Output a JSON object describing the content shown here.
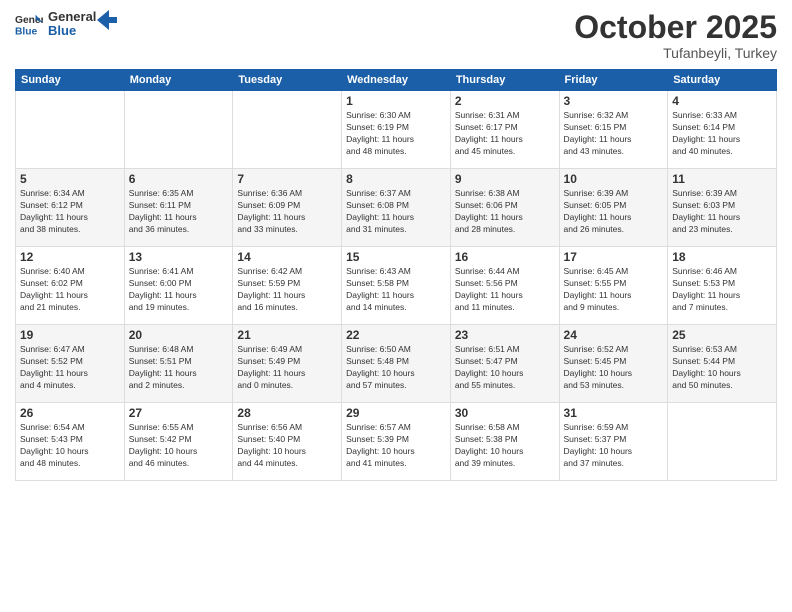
{
  "header": {
    "logo_general": "General",
    "logo_blue": "Blue",
    "month_title": "October 2025",
    "subtitle": "Tufanbeyli, Turkey"
  },
  "days_of_week": [
    "Sunday",
    "Monday",
    "Tuesday",
    "Wednesday",
    "Thursday",
    "Friday",
    "Saturday"
  ],
  "weeks": [
    [
      {
        "day": "",
        "info": ""
      },
      {
        "day": "",
        "info": ""
      },
      {
        "day": "",
        "info": ""
      },
      {
        "day": "1",
        "info": "Sunrise: 6:30 AM\nSunset: 6:19 PM\nDaylight: 11 hours\nand 48 minutes."
      },
      {
        "day": "2",
        "info": "Sunrise: 6:31 AM\nSunset: 6:17 PM\nDaylight: 11 hours\nand 45 minutes."
      },
      {
        "day": "3",
        "info": "Sunrise: 6:32 AM\nSunset: 6:15 PM\nDaylight: 11 hours\nand 43 minutes."
      },
      {
        "day": "4",
        "info": "Sunrise: 6:33 AM\nSunset: 6:14 PM\nDaylight: 11 hours\nand 40 minutes."
      }
    ],
    [
      {
        "day": "5",
        "info": "Sunrise: 6:34 AM\nSunset: 6:12 PM\nDaylight: 11 hours\nand 38 minutes."
      },
      {
        "day": "6",
        "info": "Sunrise: 6:35 AM\nSunset: 6:11 PM\nDaylight: 11 hours\nand 36 minutes."
      },
      {
        "day": "7",
        "info": "Sunrise: 6:36 AM\nSunset: 6:09 PM\nDaylight: 11 hours\nand 33 minutes."
      },
      {
        "day": "8",
        "info": "Sunrise: 6:37 AM\nSunset: 6:08 PM\nDaylight: 11 hours\nand 31 minutes."
      },
      {
        "day": "9",
        "info": "Sunrise: 6:38 AM\nSunset: 6:06 PM\nDaylight: 11 hours\nand 28 minutes."
      },
      {
        "day": "10",
        "info": "Sunrise: 6:39 AM\nSunset: 6:05 PM\nDaylight: 11 hours\nand 26 minutes."
      },
      {
        "day": "11",
        "info": "Sunrise: 6:39 AM\nSunset: 6:03 PM\nDaylight: 11 hours\nand 23 minutes."
      }
    ],
    [
      {
        "day": "12",
        "info": "Sunrise: 6:40 AM\nSunset: 6:02 PM\nDaylight: 11 hours\nand 21 minutes."
      },
      {
        "day": "13",
        "info": "Sunrise: 6:41 AM\nSunset: 6:00 PM\nDaylight: 11 hours\nand 19 minutes."
      },
      {
        "day": "14",
        "info": "Sunrise: 6:42 AM\nSunset: 5:59 PM\nDaylight: 11 hours\nand 16 minutes."
      },
      {
        "day": "15",
        "info": "Sunrise: 6:43 AM\nSunset: 5:58 PM\nDaylight: 11 hours\nand 14 minutes."
      },
      {
        "day": "16",
        "info": "Sunrise: 6:44 AM\nSunset: 5:56 PM\nDaylight: 11 hours\nand 11 minutes."
      },
      {
        "day": "17",
        "info": "Sunrise: 6:45 AM\nSunset: 5:55 PM\nDaylight: 11 hours\nand 9 minutes."
      },
      {
        "day": "18",
        "info": "Sunrise: 6:46 AM\nSunset: 5:53 PM\nDaylight: 11 hours\nand 7 minutes."
      }
    ],
    [
      {
        "day": "19",
        "info": "Sunrise: 6:47 AM\nSunset: 5:52 PM\nDaylight: 11 hours\nand 4 minutes."
      },
      {
        "day": "20",
        "info": "Sunrise: 6:48 AM\nSunset: 5:51 PM\nDaylight: 11 hours\nand 2 minutes."
      },
      {
        "day": "21",
        "info": "Sunrise: 6:49 AM\nSunset: 5:49 PM\nDaylight: 11 hours\nand 0 minutes."
      },
      {
        "day": "22",
        "info": "Sunrise: 6:50 AM\nSunset: 5:48 PM\nDaylight: 10 hours\nand 57 minutes."
      },
      {
        "day": "23",
        "info": "Sunrise: 6:51 AM\nSunset: 5:47 PM\nDaylight: 10 hours\nand 55 minutes."
      },
      {
        "day": "24",
        "info": "Sunrise: 6:52 AM\nSunset: 5:45 PM\nDaylight: 10 hours\nand 53 minutes."
      },
      {
        "day": "25",
        "info": "Sunrise: 6:53 AM\nSunset: 5:44 PM\nDaylight: 10 hours\nand 50 minutes."
      }
    ],
    [
      {
        "day": "26",
        "info": "Sunrise: 6:54 AM\nSunset: 5:43 PM\nDaylight: 10 hours\nand 48 minutes."
      },
      {
        "day": "27",
        "info": "Sunrise: 6:55 AM\nSunset: 5:42 PM\nDaylight: 10 hours\nand 46 minutes."
      },
      {
        "day": "28",
        "info": "Sunrise: 6:56 AM\nSunset: 5:40 PM\nDaylight: 10 hours\nand 44 minutes."
      },
      {
        "day": "29",
        "info": "Sunrise: 6:57 AM\nSunset: 5:39 PM\nDaylight: 10 hours\nand 41 minutes."
      },
      {
        "day": "30",
        "info": "Sunrise: 6:58 AM\nSunset: 5:38 PM\nDaylight: 10 hours\nand 39 minutes."
      },
      {
        "day": "31",
        "info": "Sunrise: 6:59 AM\nSunset: 5:37 PM\nDaylight: 10 hours\nand 37 minutes."
      },
      {
        "day": "",
        "info": ""
      }
    ]
  ]
}
